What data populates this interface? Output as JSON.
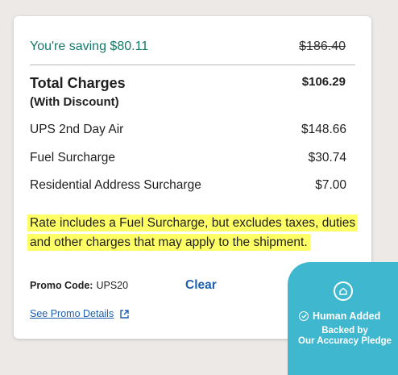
{
  "savings": {
    "label": "You're saving $80.11",
    "original_price": "$186.40"
  },
  "total": {
    "title": "Total Charges",
    "subtitle": "(With Discount)",
    "amount": "$106.29"
  },
  "charges": [
    {
      "label": "UPS 2nd Day Air",
      "amount": "$148.66"
    },
    {
      "label": "Fuel Surcharge",
      "amount": "$30.74"
    },
    {
      "label": "Residential Address Surcharge",
      "amount": "$7.00"
    }
  ],
  "notice": "Rate includes a Fuel Surcharge, but excludes taxes, duties and other charges that may apply to the shipment.",
  "promo": {
    "label": "Promo Code:",
    "code": "UPS20",
    "clear_label": "Clear",
    "details_link": "See Promo Details"
  },
  "badge": {
    "title": "Human Added",
    "line1": "Backed by",
    "line2": "Our Accuracy Pledge"
  },
  "colors": {
    "savings_green": "#14796b",
    "link_blue": "#1e5fad",
    "highlight_yellow": "#ffff66",
    "badge_teal": "#3fb8cf"
  },
  "icons": {
    "external_link": "external-link-icon",
    "home": "home-icon",
    "check": "check-circle-icon"
  }
}
